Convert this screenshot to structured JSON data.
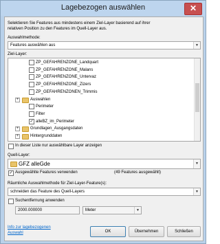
{
  "window": {
    "title": "Lagebezogen auswählen",
    "close_glyph": "✕"
  },
  "description": [
    "Selektieren Sie Features aus mindestens einem Ziel-Layer basierend auf ihrer",
    "relativen Position zu den Features im Quell-Layer aus."
  ],
  "method": {
    "label": "Auswahlmethode:",
    "value": "Features auswählen aus"
  },
  "target": {
    "label": "Ziel-Layer:",
    "items": [
      {
        "label": "ZP_GEFAHRENZONE_Landquart",
        "checked": false,
        "expand": "",
        "folder": false
      },
      {
        "label": "ZP_GEFAHRENZONE_Malans",
        "checked": false,
        "expand": "",
        "folder": false
      },
      {
        "label": "ZP_GEFAHRENZONE_Untervaz",
        "checked": false,
        "expand": "",
        "folder": false
      },
      {
        "label": "ZP_GEFAHRENZONE_Zizers",
        "checked": false,
        "expand": "",
        "folder": false
      },
      {
        "label": "ZP_GEFAHRENZONEN_Trimmis",
        "checked": false,
        "expand": "",
        "folder": false
      },
      {
        "label": "Auswahlen",
        "checked": false,
        "expand": "+",
        "folder": true
      },
      {
        "label": "Perimeter",
        "checked": false,
        "expand": "",
        "folder": false
      },
      {
        "label": "Filter",
        "checked": false,
        "expand": "",
        "folder": false
      },
      {
        "label": "alleBZ_im_Perimeter",
        "checked": true,
        "expand": "",
        "folder": false
      },
      {
        "label": "Grundlagen_Ausgangsdaten",
        "checked": false,
        "expand": "+",
        "folder": true
      },
      {
        "label": "Hintergrunddaten",
        "checked": false,
        "expand": "+",
        "folder": true
      }
    ],
    "only_selectable_label": "In dieser Liste nur auswählbare Layer anzeigen"
  },
  "source": {
    "label": "Quell-Layer:",
    "value": "GFZ alleGde",
    "use_selected_label": "Ausgewählte Features verwenden",
    "selected_count": "(49 Features ausgewählt)"
  },
  "spatial": {
    "label": "Räumliche Auswahlmethode für Ziel-Layer-Feature(s):",
    "value": "schneiden das Feature des Quell-Layers"
  },
  "search_distance": {
    "label": "Suchentfernung anwenden",
    "value": "2000.000000",
    "unit": "Meter"
  },
  "footer": {
    "help_link": [
      "Info zur lagebezogenen",
      "Auswahl"
    ],
    "ok": "OK",
    "apply": "Übernehmen",
    "close": "Schließen"
  },
  "icons": {
    "dropdown": "▼",
    "check": "✓",
    "expand": "+"
  }
}
